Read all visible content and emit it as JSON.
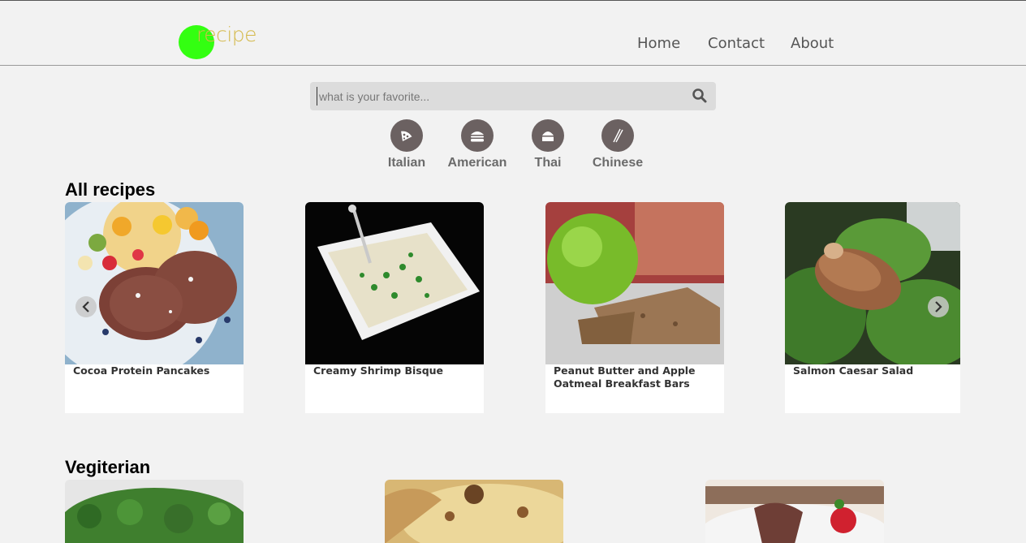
{
  "logo": {
    "text": "recipe"
  },
  "nav": {
    "home": "Home",
    "contact": "Contact",
    "about": "About"
  },
  "search": {
    "placeholder": "what is your favorite..."
  },
  "categories": [
    {
      "label": "Italian",
      "icon": "pizza-icon"
    },
    {
      "label": "American",
      "icon": "burger-icon"
    },
    {
      "label": "Thai",
      "icon": "cake-icon"
    },
    {
      "label": "Chinese",
      "icon": "chopsticks-icon"
    }
  ],
  "sections": {
    "all": {
      "title": "All recipes",
      "cards": [
        {
          "title": "Cocoa Protein Pancakes"
        },
        {
          "title": "Creamy Shrimp Bisque"
        },
        {
          "title": "Peanut Butter and Apple Oatmeal Breakfast Bars"
        },
        {
          "title": "Salmon Caesar Salad"
        }
      ]
    },
    "veg": {
      "title": "Vegiterian"
    }
  },
  "colors": {
    "accent": "#33ff11",
    "logo_text": "#d4b94a",
    "category_circle": "#6b6161"
  }
}
